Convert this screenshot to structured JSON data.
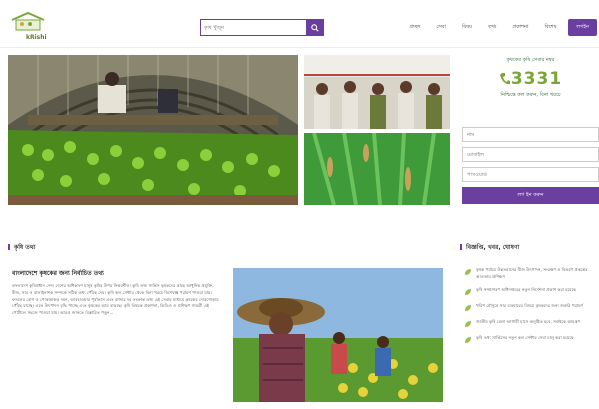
{
  "header": {
    "logo_text": "kRishi",
    "search": {
      "placeholder": "কৃষি খুঁজুন"
    },
    "nav": [
      {
        "label": "প্রচ্ছদ"
      },
      {
        "label": "সেবা"
      },
      {
        "label": "বিষয়"
      },
      {
        "label": "তথ্য"
      },
      {
        "label": "প্রকাশনা"
      },
      {
        "label": "বিশেষ"
      },
      {
        "label": "লগইন"
      }
    ]
  },
  "brand": {
    "top_text": "কৃষকের কৃষি সেবার নম্বর",
    "number": "3331",
    "sub_text": "নিশ্চিন্তে কল করুন, বিনা খরচে"
  },
  "login": {
    "username_placeholder": "নাম",
    "phone_placeholder": "মোবাইল",
    "password_placeholder": "পাসওয়ার্ড",
    "button_label": "লগ ইন করুন"
  },
  "main": {
    "section_title": "কৃষি তথ্য",
    "article_title": "বাংলাদেশে কৃষকের জন্য নির্বাচিত তথ্য",
    "article_body": "বাংলাদেশ কৃষিপ্রধান দেশ। দেশের অধিকাংশ মানুষ কৃষির উপর নির্ভরশীল। কৃষি তথ্য সার্ভিস কৃষকদের কাছে আধুনিক প্রযুক্তি, বীজ, সার ও বালাইনাশক সম্পর্কে সঠিক তথ্য পৌঁছে দেয়। কৃষি কল সেন্টার থেকে বিনা খরচে বিশেষজ্ঞ পরামর্শ পাওয়া যায়। ফসলের রোগ ও পোকামাকড় দমন, আবহাওয়ার পূর্বাভাস এবং বাজার দর সংক্রান্ত তথ্য এই সেবার মাধ্যমে কৃষকের দোরগোড়ায় পৌঁছে যাচ্ছে। এতে উৎপাদন বৃদ্ধি পাচ্ছে এবং কৃষকের আয় বাড়ছে। কৃষি বিষয়ক প্রকাশনা, ভিডিও ও প্রশিক্ষণ সামগ্রী এই পোর্টালে সহজে পাওয়া যায়। আরও জানতে বিস্তারিত পড়ুন..."
  },
  "news": {
    "section_title": "বিজ্ঞপ্তি, খবর, ঘোষণা",
    "items": [
      {
        "text": "কৃষক পর্যায়ে উন্নতমানের বীজ উৎপাদন, সংরক্ষণ ও বিতরণ প্রকল্পের আওতায় প্রশিক্ষণ"
      },
      {
        "text": "কৃষি সম্প্রসারণ অধিদপ্তরের নতুন নির্দেশনা প্রকাশ করা হয়েছে"
      },
      {
        "text": "খরিপ মৌসুমে সার ব্যবহারের বিষয়ে কৃষকদের জন্য জরুরি পরামর্শ"
      },
      {
        "text": "জাতীয় কৃষি মেলা আগামী মাসে অনুষ্ঠিত হবে, সবাইকে আমন্ত্রণ"
      },
      {
        "text": "কৃষি তথ্য সার্ভিসের নতুন কল সেন্টার সেবা চালু করা হয়েছে"
      }
    ]
  },
  "colors": {
    "accent": "#6b3fa0",
    "brand_green": "#7aa636"
  }
}
